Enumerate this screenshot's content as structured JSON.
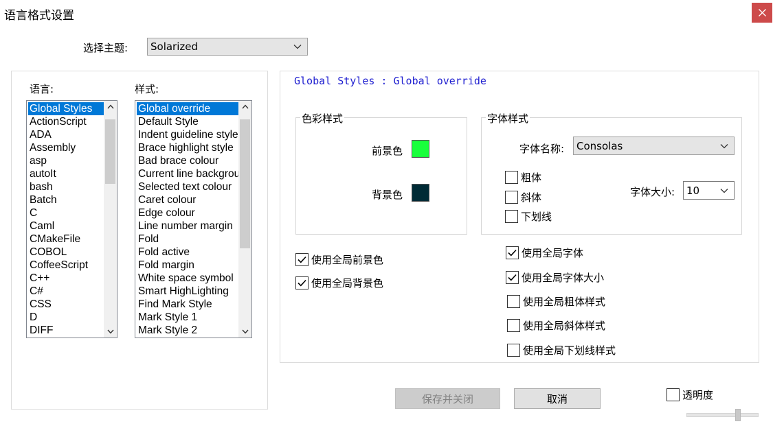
{
  "window": {
    "title": "语言格式设置",
    "close_glyph": "close-icon"
  },
  "theme": {
    "label": "选择主题:",
    "selected": "Solarized"
  },
  "languages": {
    "label": "语言:",
    "items": [
      "Global Styles",
      "ActionScript",
      "ADA",
      "Assembly",
      "asp",
      "autoIt",
      "bash",
      "Batch",
      "C",
      "Caml",
      "CMakeFile",
      "COBOL",
      "CoffeeScript",
      "C++",
      "C#",
      "CSS",
      "D",
      "DIFF"
    ],
    "selected_index": 0
  },
  "styles": {
    "label": "样式:",
    "items": [
      "Global override",
      "Default Style",
      "Indent guideline style",
      "Brace highlight style",
      "Bad brace colour",
      "Current line background colour",
      "Selected text colour",
      "Caret colour",
      "Edge colour",
      "Line number margin",
      "Fold",
      "Fold active",
      "Fold margin",
      "White space symbol",
      "Smart HighLighting",
      "Find Mark Style",
      "Mark Style 1",
      "Mark Style 2"
    ],
    "selected_index": 0
  },
  "path": "Global Styles : Global override",
  "color_style": {
    "title": "色彩样式",
    "foreground_label": "前景色",
    "background_label": "背景色",
    "foreground_color": "#19ff3c",
    "background_color": "#002b36"
  },
  "font_style": {
    "title": "字体样式",
    "name_label": "字体名称:",
    "name_value": "Consolas",
    "bold_label": "粗体",
    "italic_label": "斜体",
    "underline_label": "下划线",
    "size_label": "字体大小:",
    "size_value": "10"
  },
  "global_options": {
    "use_global_fg": {
      "label": "使用全局前景色",
      "checked": true
    },
    "use_global_bg": {
      "label": "使用全局背景色",
      "checked": true
    },
    "use_global_font": {
      "label": "使用全局字体",
      "checked": true
    },
    "use_global_font_size": {
      "label": "使用全局字体大小",
      "checked": true
    },
    "use_global_bold": {
      "label": "使用全局粗体样式",
      "checked": false
    },
    "use_global_italic": {
      "label": "使用全局斜体样式",
      "checked": false
    },
    "use_global_underline": {
      "label": "使用全局下划线样式",
      "checked": false
    }
  },
  "buttons": {
    "save_close": "保存并关闭",
    "cancel": "取消"
  },
  "transparency": {
    "label": "透明度",
    "checked": false,
    "level": 0.73
  },
  "colors": {
    "accent": "#0078d7",
    "close_bg": "#cd4a4a",
    "path_text": "#2020d0"
  }
}
